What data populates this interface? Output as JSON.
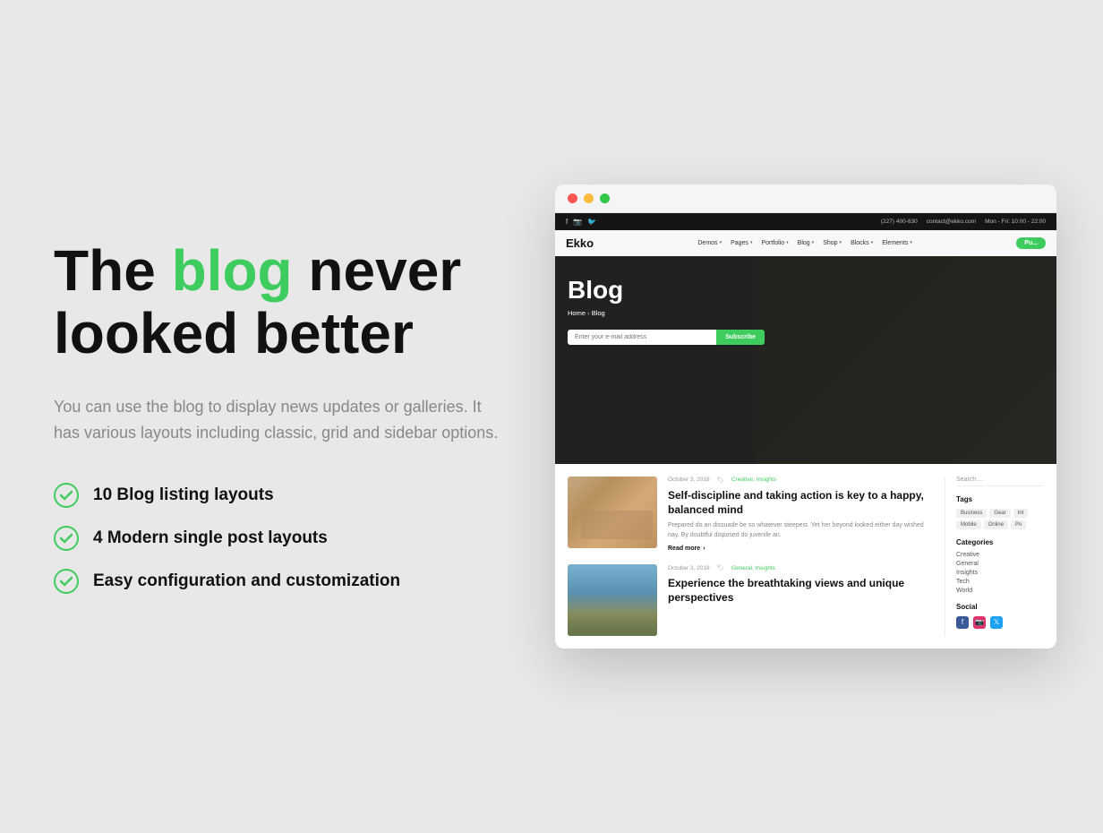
{
  "background": "#e8e8e8",
  "left": {
    "headline_part1": "The ",
    "headline_green": "blog",
    "headline_part2": " never",
    "headline_line2": "looked better",
    "description": "You can use the blog to display news updates or galleries. It has various layouts including classic, grid and sidebar options.",
    "features": [
      {
        "id": "f1",
        "text": "10 Blog listing layouts"
      },
      {
        "id": "f2",
        "text": "4 Modern single post layouts"
      },
      {
        "id": "f3",
        "text": "Easy configuration and customization"
      }
    ]
  },
  "browser": {
    "brand": "Ekko",
    "nav_links": [
      "Demos",
      "Pages",
      "Portfolio",
      "Blog",
      "Shop",
      "Blocks",
      "Elements"
    ],
    "purchase_label": "Pu...",
    "topbar": {
      "phone": "(227) 400-630",
      "email": "contact@ekko.com",
      "hours": "Mon - Fri: 10:00 - 22:00"
    },
    "hero": {
      "title": "Blog",
      "breadcrumb_home": "Home",
      "breadcrumb_current": "Blog",
      "email_placeholder": "Enter your e-mail address",
      "subscribe_label": "Subscribe"
    },
    "posts": [
      {
        "id": "post1",
        "date": "October 3, 2018",
        "categories": "Creative, Insights",
        "title": "Self-discipline and taking action is key to a happy, balanced mind",
        "excerpt": "Prepared do an dissuade be so whatever steepest. Yet her beyond looked either day wished nay. By doubtful disposed do juvenile an.",
        "read_more": "Read more"
      },
      {
        "id": "post2",
        "date": "October 3, 2018",
        "categories": "General, Insights",
        "title": "Experience the breathtaking views and unique perspectives",
        "excerpt": "",
        "read_more": ""
      }
    ],
    "sidebar": {
      "search_placeholder": "Search ...",
      "tags_label": "Tags",
      "tags": [
        "Business",
        "Gear",
        "Int",
        "Mobile",
        "Online",
        "Po"
      ],
      "categories_label": "Categories",
      "categories": [
        "Creative",
        "General",
        "Insights",
        "Tech",
        "World"
      ],
      "social_label": "Social"
    }
  }
}
